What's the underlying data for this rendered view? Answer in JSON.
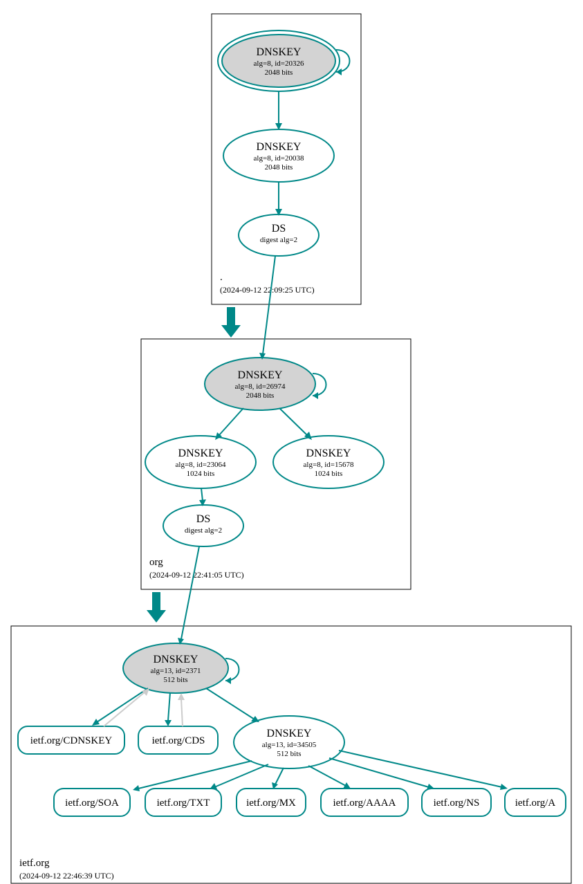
{
  "colors": {
    "teal": "#088",
    "ksk_fill": "#d3d3d3"
  },
  "zones": {
    "root": {
      "label": ".",
      "timestamp": "(2024-09-12 22:09:25 UTC)",
      "ksk": {
        "title": "DNSKEY",
        "sub1": "alg=8, id=20326",
        "sub2": "2048 bits"
      },
      "zsk": {
        "title": "DNSKEY",
        "sub1": "alg=8, id=20038",
        "sub2": "2048 bits"
      },
      "ds": {
        "title": "DS",
        "sub1": "digest alg=2"
      }
    },
    "org": {
      "label": "org",
      "timestamp": "(2024-09-12 22:41:05 UTC)",
      "ksk": {
        "title": "DNSKEY",
        "sub1": "alg=8, id=26974",
        "sub2": "2048 bits"
      },
      "zsk1": {
        "title": "DNSKEY",
        "sub1": "alg=8, id=23064",
        "sub2": "1024 bits"
      },
      "zsk2": {
        "title": "DNSKEY",
        "sub1": "alg=8, id=15678",
        "sub2": "1024 bits"
      },
      "ds": {
        "title": "DS",
        "sub1": "digest alg=2"
      }
    },
    "ietf": {
      "label": "ietf.org",
      "timestamp": "(2024-09-12 22:46:39 UTC)",
      "ksk": {
        "title": "DNSKEY",
        "sub1": "alg=13, id=2371",
        "sub2": "512 bits"
      },
      "zsk": {
        "title": "DNSKEY",
        "sub1": "alg=13, id=34505",
        "sub2": "512 bits"
      },
      "rr": {
        "cdnskey": "ietf.org/CDNSKEY",
        "cds": "ietf.org/CDS",
        "soa": "ietf.org/SOA",
        "txt": "ietf.org/TXT",
        "mx": "ietf.org/MX",
        "aaaa": "ietf.org/AAAA",
        "ns": "ietf.org/NS",
        "a": "ietf.org/A"
      }
    }
  }
}
